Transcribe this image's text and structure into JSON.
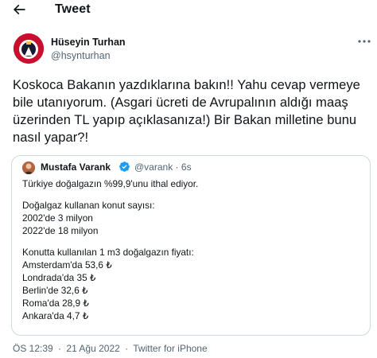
{
  "header": {
    "title": "Tweet",
    "back_icon": "back-arrow-icon"
  },
  "tweet": {
    "author_name": "Hüseyin Turhan",
    "author_handle": "@hsynturhan",
    "text": "Koskoca Bakanın yazdıklarına bakın!! Yahu cevap vermeye bile utanıyorum. (Asgari ücreti de Avrupalının aldığı maaş üzerinden TL yapıp açıklasanıza!) Bir Bakan milletine bunu nasıl yapar?!",
    "time": "ÖS 12:39",
    "date": "21 Ağu 2022",
    "app": "Twitter for iPhone",
    "separator": "·"
  },
  "quote": {
    "author_name": "Mustafa Varank",
    "verified_icon": "verified-badge-icon",
    "author_handle": "@varank",
    "age": "6s",
    "separator": "·",
    "lines": [
      "Türkiye doğalgazın %99,9'unu ithal ediyor.",
      "",
      "Doğalgaz kullanan konut sayısı:",
      "2002'de 3 milyon",
      "2022'de 18 milyon",
      "",
      "Konutta kullanılan 1 m3 doğalgazın fiyatı:",
      "Amsterdam'da 53,6 ₺",
      "Londrada'da 35 ₺",
      "Berlin'de 32,6 ₺",
      "Roma'da 28,9 ₺",
      "Ankara'da 4,7 ₺"
    ]
  },
  "colors": {
    "text": "#0f1419",
    "secondary": "#536471",
    "verified": "#1d9bf0",
    "border": "#cfd9de"
  }
}
